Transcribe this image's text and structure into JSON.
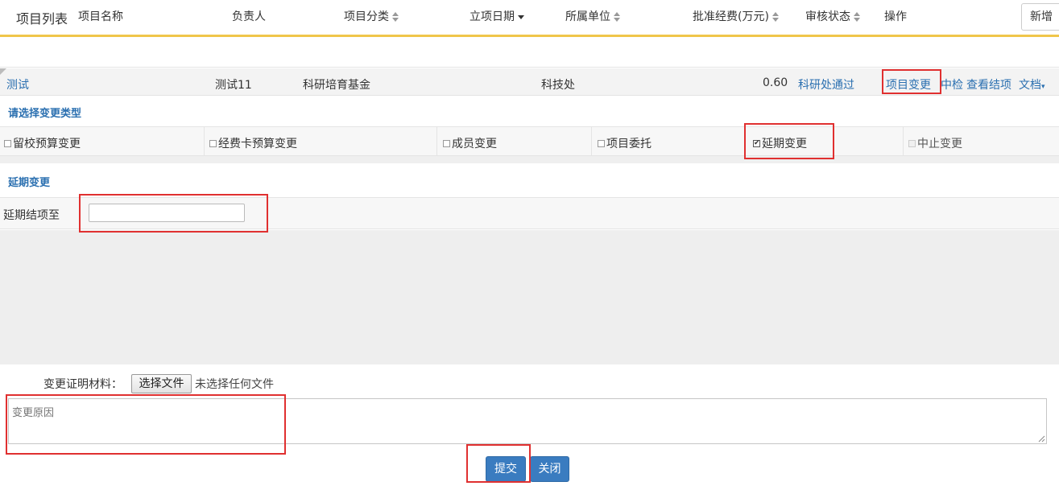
{
  "header": {
    "title": "项目列表",
    "new_button": "新增"
  },
  "table": {
    "columns": [
      {
        "label": "项目名称",
        "sort": "none"
      },
      {
        "label": "负责人",
        "sort": "none"
      },
      {
        "label": "项目分类",
        "sort": "both"
      },
      {
        "label": "立项日期",
        "sort": "desc"
      },
      {
        "label": "所属单位",
        "sort": "both"
      },
      {
        "label": "批准经费(万元)",
        "sort": "both"
      },
      {
        "label": "审核状态",
        "sort": "both"
      },
      {
        "label": "操作",
        "sort": "none"
      }
    ],
    "row": {
      "name": "测试",
      "owner": "测试11",
      "category": "科研培育基金",
      "unit": "科技处",
      "funds": "0.60",
      "status": "科研处通过",
      "actions": [
        "项目变更",
        "中检",
        "查看结项",
        "文档"
      ]
    }
  },
  "change_type": {
    "heading": "请选择变更类型",
    "options": [
      {
        "label": "留校预算变更",
        "checked": false,
        "disabled": false
      },
      {
        "label": "经费卡预算变更",
        "checked": false,
        "disabled": false
      },
      {
        "label": "成员变更",
        "checked": false,
        "disabled": false
      },
      {
        "label": "项目委托",
        "checked": false,
        "disabled": false
      },
      {
        "label": "延期变更",
        "checked": true,
        "disabled": false
      },
      {
        "label": "中止变更",
        "checked": false,
        "disabled": true
      }
    ]
  },
  "delay": {
    "heading": "延期变更",
    "field_label": "延期结项至",
    "value": ""
  },
  "attachment": {
    "label": "变更证明材料：",
    "choose_button": "选择文件",
    "no_file_text": "未选择任何文件"
  },
  "reason": {
    "placeholder": "变更原因",
    "value": ""
  },
  "footer": {
    "submit": "提交",
    "close": "关闭"
  },
  "colors": {
    "accent": "#2a6fb0",
    "divider": "#f0c64a",
    "primary_button": "#3a7cc0",
    "highlight": "#e03030"
  }
}
